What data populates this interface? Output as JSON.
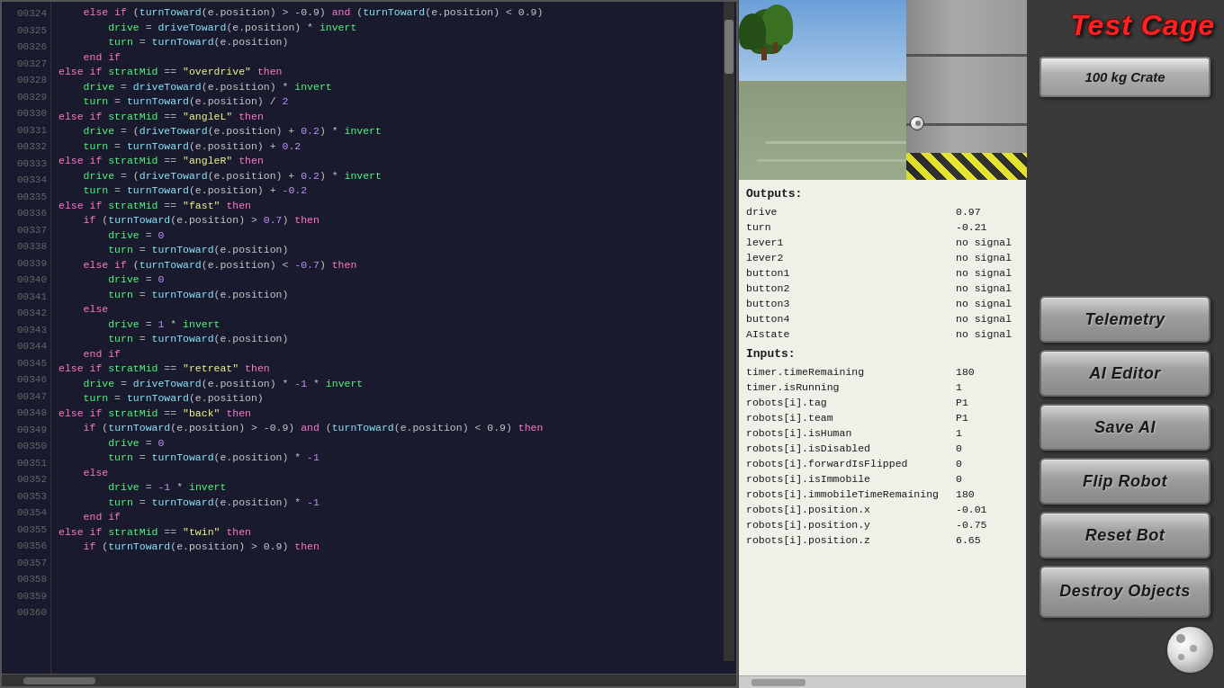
{
  "title": "Test Cage",
  "buttons": {
    "crate": "100 kg Crate",
    "telemetry": "Telemetry",
    "ai_editor": "AI Editor",
    "save_ai": "Save AI",
    "flip_robot": "Flip Robot",
    "reset_bot": "Reset Bot",
    "destroy_objects": "Destroy Objects"
  },
  "telemetry": {
    "outputs_label": "Outputs:",
    "inputs_label": "Inputs:",
    "outputs": [
      {
        "key": "drive",
        "value": "0.97"
      },
      {
        "key": "turn",
        "value": "-0.21"
      },
      {
        "key": "lever1",
        "value": "no signal"
      },
      {
        "key": "lever2",
        "value": "no signal"
      },
      {
        "key": "button1",
        "value": "no signal"
      },
      {
        "key": "button2",
        "value": "no signal"
      },
      {
        "key": "button3",
        "value": "no signal"
      },
      {
        "key": "button4",
        "value": "no signal"
      },
      {
        "key": "AIstate",
        "value": "no signal"
      }
    ],
    "inputs": [
      {
        "key": "timer.timeRemaining",
        "value": "180"
      },
      {
        "key": "timer.isRunning",
        "value": "1"
      },
      {
        "key": "robots[i].tag",
        "value": "P1"
      },
      {
        "key": "robots[i].team",
        "value": "P1"
      },
      {
        "key": "robots[i].isHuman",
        "value": "1"
      },
      {
        "key": "robots[i].isDisabled",
        "value": "0"
      },
      {
        "key": "robots[i].forwardIsFlipped",
        "value": "0"
      },
      {
        "key": "robots[i].isImmobile",
        "value": "0"
      },
      {
        "key": "robots[i].immobileTimeRemaining",
        "value": "180"
      },
      {
        "key": "robots[i].position.x",
        "value": "-0.01"
      },
      {
        "key": "robots[i].position.y",
        "value": "-0.75"
      },
      {
        "key": "robots[i].position.z",
        "value": "6.65"
      }
    ]
  },
  "code_lines": [
    {
      "num": "00324",
      "html": "<span class='plain'>    </span><span class='kw'>else if</span><span class='plain'> (</span><span class='fn'>turnToward</span><span class='plain'>(e.position) &gt; -0.9) </span><span class='kw'>and</span><span class='plain'> (</span><span class='fn'>turnToward</span><span class='plain'>(e.position) &lt; 0.9)</span>"
    },
    {
      "num": "00325",
      "html": "<span class='plain'>        </span><span class='var'>drive</span><span class='plain'> = </span><span class='fn'>driveToward</span><span class='plain'>(e.position) * </span><span class='var'>invert</span>"
    },
    {
      "num": "00326",
      "html": "<span class='plain'>        </span><span class='var'>turn</span><span class='plain'> = </span><span class='fn'>turnToward</span><span class='plain'>(e.position)</span>"
    },
    {
      "num": "00327",
      "html": "<span class='plain'>    </span><span class='kw'>end if</span>"
    },
    {
      "num": "00328",
      "html": "<span class='kw'>else if</span><span class='plain'> </span><span class='var'>stratMid</span><span class='plain'> == </span><span class='str'>\"overdrive\"</span><span class='plain'> </span><span class='kw'>then</span>"
    },
    {
      "num": "00329",
      "html": "<span class='plain'>    </span><span class='var'>drive</span><span class='plain'> = </span><span class='fn'>driveToward</span><span class='plain'>(e.position) * </span><span class='var'>invert</span>"
    },
    {
      "num": "00330",
      "html": "<span class='plain'>    </span><span class='var'>turn</span><span class='plain'> = </span><span class='fn'>turnToward</span><span class='plain'>(e.position) / </span><span class='num'>2</span>"
    },
    {
      "num": "00331",
      "html": "<span class='kw'>else if</span><span class='plain'> </span><span class='var'>stratMid</span><span class='plain'> == </span><span class='str'>\"angleL\"</span><span class='plain'> </span><span class='kw'>then</span>"
    },
    {
      "num": "00332",
      "html": "<span class='plain'>    </span><span class='var'>drive</span><span class='plain'> = (</span><span class='fn'>driveToward</span><span class='plain'>(e.position) + </span><span class='num'>0.2</span><span class='plain'>) * </span><span class='var'>invert</span>"
    },
    {
      "num": "00333",
      "html": "<span class='plain'>    </span><span class='var'>turn</span><span class='plain'> = </span><span class='fn'>turnToward</span><span class='plain'>(e.position) + </span><span class='num'>0.2</span>"
    },
    {
      "num": "00334",
      "html": "<span class='kw'>else if</span><span class='plain'> </span><span class='var'>stratMid</span><span class='plain'> == </span><span class='str'>\"angleR\"</span><span class='plain'> </span><span class='kw'>then</span>"
    },
    {
      "num": "00335",
      "html": "<span class='plain'>    </span><span class='var'>drive</span><span class='plain'> = (</span><span class='fn'>driveToward</span><span class='plain'>(e.position) + </span><span class='num'>0.2</span><span class='plain'>) * </span><span class='var'>invert</span>"
    },
    {
      "num": "00336",
      "html": "<span class='plain'>    </span><span class='var'>turn</span><span class='plain'> = </span><span class='fn'>turnToward</span><span class='plain'>(e.position) + </span><span class='num'>-0.2</span>"
    },
    {
      "num": "00337",
      "html": "<span class='kw'>else if</span><span class='plain'> </span><span class='var'>stratMid</span><span class='plain'> == </span><span class='str'>\"fast\"</span><span class='plain'> </span><span class='kw'>then</span>"
    },
    {
      "num": "00338",
      "html": "<span class='plain'>    </span><span class='kw'>if</span><span class='plain'> (</span><span class='fn'>turnToward</span><span class='plain'>(e.position) &gt; </span><span class='num'>0.7</span><span class='plain'>) </span><span class='kw'>then</span>"
    },
    {
      "num": "00339",
      "html": "<span class='plain'>        </span><span class='var'>drive</span><span class='plain'> = </span><span class='num'>0</span>"
    },
    {
      "num": "00340",
      "html": "<span class='plain'>        </span><span class='var'>turn</span><span class='plain'> = </span><span class='fn'>turnToward</span><span class='plain'>(e.position)</span>"
    },
    {
      "num": "00341",
      "html": "<span class='plain'>    </span><span class='kw'>else if</span><span class='plain'> (</span><span class='fn'>turnToward</span><span class='plain'>(e.position) &lt; </span><span class='num'>-0.7</span><span class='plain'>) </span><span class='kw'>then</span>"
    },
    {
      "num": "00342",
      "html": "<span class='plain'>        </span><span class='var'>drive</span><span class='plain'> = </span><span class='num'>0</span>"
    },
    {
      "num": "00343",
      "html": "<span class='plain'>        </span><span class='var'>turn</span><span class='plain'> = </span><span class='fn'>turnToward</span><span class='plain'>(e.position)</span>"
    },
    {
      "num": "00344",
      "html": "<span class='plain'>    </span><span class='kw'>else</span>"
    },
    {
      "num": "00345",
      "html": "<span class='plain'>        </span><span class='var'>drive</span><span class='plain'> = </span><span class='num'>1</span><span class='plain'> * </span><span class='var'>invert</span>"
    },
    {
      "num": "00346",
      "html": "<span class='plain'>        </span><span class='var'>turn</span><span class='plain'> = </span><span class='fn'>turnToward</span><span class='plain'>(e.position)</span>"
    },
    {
      "num": "00347",
      "html": "<span class='plain'>    </span><span class='kw'>end if</span>"
    },
    {
      "num": "00348",
      "html": "<span class='kw'>else if</span><span class='plain'> </span><span class='var'>stratMid</span><span class='plain'> == </span><span class='str'>\"retreat\"</span><span class='plain'> </span><span class='kw'>then</span>"
    },
    {
      "num": "00349",
      "html": "<span class='plain'>    </span><span class='var'>drive</span><span class='plain'> = </span><span class='fn'>driveToward</span><span class='plain'>(e.position) * </span><span class='num'>-1</span><span class='plain'> * </span><span class='var'>invert</span>"
    },
    {
      "num": "00350",
      "html": "<span class='plain'>    </span><span class='var'>turn</span><span class='plain'> = </span><span class='fn'>turnToward</span><span class='plain'>(e.position)</span>"
    },
    {
      "num": "00351",
      "html": "<span class='kw'>else if</span><span class='plain'> </span><span class='var'>stratMid</span><span class='plain'> == </span><span class='str'>\"back\"</span><span class='plain'> </span><span class='kw'>then</span>"
    },
    {
      "num": "00352",
      "html": "<span class='plain'>    </span><span class='kw'>if</span><span class='plain'> (</span><span class='fn'>turnToward</span><span class='plain'>(e.position) &gt; -0.9) </span><span class='kw'>and</span><span class='plain'> (</span><span class='fn'>turnToward</span><span class='plain'>(e.position) &lt; 0.9) </span><span class='kw'>then</span>"
    },
    {
      "num": "00353",
      "html": "<span class='plain'>        </span><span class='var'>drive</span><span class='plain'> = </span><span class='num'>0</span>"
    },
    {
      "num": "00354",
      "html": "<span class='plain'>        </span><span class='var'>turn</span><span class='plain'> = </span><span class='fn'>turnToward</span><span class='plain'>(e.position) * </span><span class='num'>-1</span>"
    },
    {
      "num": "00355",
      "html": "<span class='plain'>    </span><span class='kw'>else</span>"
    },
    {
      "num": "00356",
      "html": "<span class='plain'>        </span><span class='var'>drive</span><span class='plain'> = </span><span class='num'>-1</span><span class='plain'> * </span><span class='var'>invert</span>"
    },
    {
      "num": "00357",
      "html": "<span class='plain'>        </span><span class='var'>turn</span><span class='plain'> = </span><span class='fn'>turnToward</span><span class='plain'>(e.position) * </span><span class='num'>-1</span>"
    },
    {
      "num": "00358",
      "html": "<span class='plain'>    </span><span class='kw'>end if</span>"
    },
    {
      "num": "00359",
      "html": "<span class='kw'>else if</span><span class='plain'> </span><span class='var'>stratMid</span><span class='plain'> == </span><span class='str'>\"twin\"</span><span class='plain'> </span><span class='kw'>then</span>"
    },
    {
      "num": "00360",
      "html": "<span class='plain'>    </span><span class='kw'>if</span><span class='plain'> (</span><span class='fn'>turnToward</span><span class='plain'>(e.position) &gt; 0.9) </span><span class='kw'>then</span>"
    }
  ]
}
